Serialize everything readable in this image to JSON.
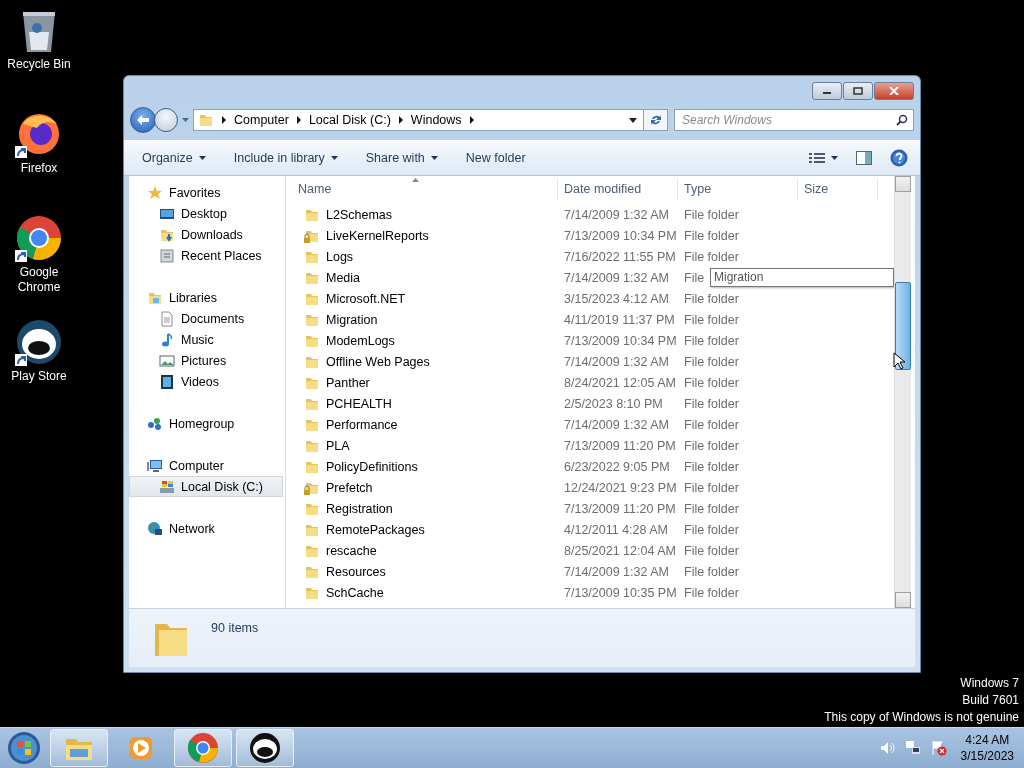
{
  "desktop_icons": [
    {
      "label": "Recycle Bin"
    },
    {
      "label": "Firefox"
    },
    {
      "label": "Google Chrome"
    },
    {
      "label": "Play Store"
    }
  ],
  "window": {
    "address": [
      "Computer",
      "Local Disk (C:)",
      "Windows"
    ],
    "search": {
      "placeholder": "Search Windows"
    },
    "toolbar": [
      {
        "label": "Organize",
        "menu": true
      },
      {
        "label": "Include in library",
        "menu": true
      },
      {
        "label": "Share with",
        "menu": true
      },
      {
        "label": "New folder",
        "menu": false
      }
    ],
    "navigation": [
      {
        "label": "Favorites",
        "selected": false,
        "children": [
          {
            "label": "Desktop",
            "selected": false
          },
          {
            "label": "Downloads",
            "selected": false
          },
          {
            "label": "Recent Places",
            "selected": false
          }
        ]
      },
      {
        "label": "Libraries",
        "selected": false,
        "children": [
          {
            "label": "Documents",
            "selected": false
          },
          {
            "label": "Music",
            "selected": false
          },
          {
            "label": "Pictures",
            "selected": false
          },
          {
            "label": "Videos",
            "selected": false
          }
        ]
      },
      {
        "label": "Homegroup",
        "selected": false
      },
      {
        "label": "Computer",
        "selected": false,
        "children": [
          {
            "label": "Local Disk (C:)",
            "selected": true
          }
        ]
      },
      {
        "label": "Network",
        "selected": false
      }
    ],
    "columns": [
      "Name",
      "Date modified",
      "Type",
      "Size"
    ],
    "rows": [
      {
        "name": "L2Schemas",
        "date": "7/14/2009 1:32 AM",
        "type": "File folder",
        "locked": false
      },
      {
        "name": "LiveKernelReports",
        "date": "7/13/2009 10:34 PM",
        "type": "File folder",
        "locked": true
      },
      {
        "name": "Logs",
        "date": "7/16/2022 11:55 PM",
        "type": "File folder",
        "locked": false
      },
      {
        "name": "Media",
        "date": "7/14/2009 1:32 AM",
        "type": "File",
        "locked": false
      },
      {
        "name": "Microsoft.NET",
        "date": "3/15/2023 4:12 AM",
        "type": "File folder",
        "locked": false
      },
      {
        "name": "Migration",
        "date": "4/11/2019 11:37 PM",
        "type": "File folder",
        "locked": false
      },
      {
        "name": "ModemLogs",
        "date": "7/13/2009 10:34 PM",
        "type": "File folder",
        "locked": false
      },
      {
        "name": "Offline Web Pages",
        "date": "7/14/2009 1:32 AM",
        "type": "File folder",
        "locked": false
      },
      {
        "name": "Panther",
        "date": "8/24/2021 12:05 AM",
        "type": "File folder",
        "locked": false
      },
      {
        "name": "PCHEALTH",
        "date": "2/5/2023 8:10 PM",
        "type": "File folder",
        "locked": false
      },
      {
        "name": "Performance",
        "date": "7/14/2009 1:32 AM",
        "type": "File folder",
        "locked": false
      },
      {
        "name": "PLA",
        "date": "7/13/2009 11:20 PM",
        "type": "File folder",
        "locked": false
      },
      {
        "name": "PolicyDefinitions",
        "date": "6/23/2022 9:05 PM",
        "type": "File folder",
        "locked": false
      },
      {
        "name": "Prefetch",
        "date": "12/24/2021 9:23 PM",
        "type": "File folder",
        "locked": true
      },
      {
        "name": "Registration",
        "date": "7/13/2009 11:20 PM",
        "type": "File folder",
        "locked": false
      },
      {
        "name": "RemotePackages",
        "date": "4/12/2011 4:28 AM",
        "type": "File folder",
        "locked": false
      },
      {
        "name": "rescache",
        "date": "8/25/2021 12:04 AM",
        "type": "File folder",
        "locked": false
      },
      {
        "name": "Resources",
        "date": "7/14/2009 1:32 AM",
        "type": "File folder",
        "locked": false
      },
      {
        "name": "SchCache",
        "date": "7/13/2009 10:35 PM",
        "type": "File folder",
        "locked": false
      }
    ],
    "tooltip": "Migration",
    "status": "90 items"
  },
  "watermark": [
    "Windows 7",
    "Build 7601",
    "This copy of Windows is not genuine"
  ],
  "taskbar": {
    "buttons": [
      {
        "running": true
      },
      {
        "running": false
      },
      {
        "running": true
      },
      {
        "running": true
      }
    ],
    "clock": {
      "time": "4:24 AM",
      "date": "3/15/2023"
    }
  }
}
